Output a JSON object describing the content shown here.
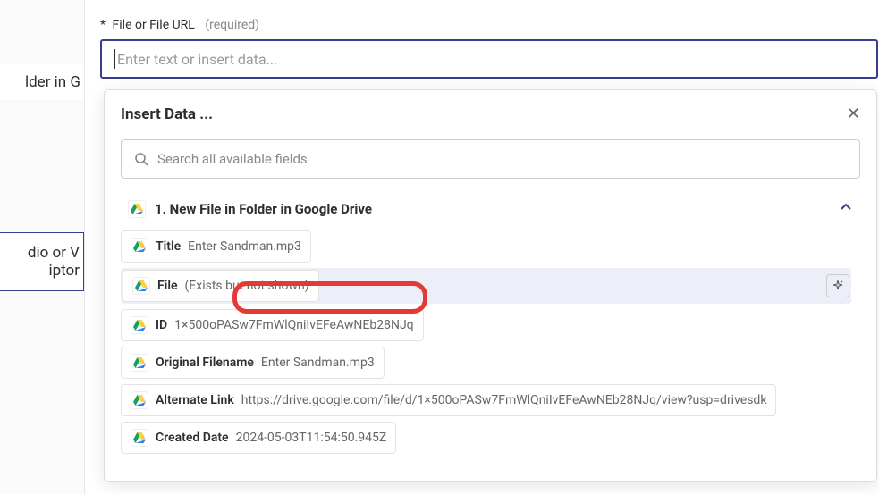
{
  "left": {
    "row1": "lder in G",
    "row2a": "dio or V",
    "row2b": "iptor"
  },
  "field": {
    "star": "*",
    "label": "File or File URL",
    "required": "(required)",
    "placeholder": "Enter text or insert data..."
  },
  "popup": {
    "title": "Insert Data ...",
    "search_placeholder": "Search all available fields",
    "source_title": "1. New File in Folder in Google Drive",
    "fields": [
      {
        "name": "Title",
        "value": "Enter Sandman.mp3"
      },
      {
        "name": "File",
        "value": "(Exists but not shown)"
      },
      {
        "name": "ID",
        "value": "1×500oPASw7FmWlQniIvEFeAwNEb28NJq"
      },
      {
        "name": "Original Filename",
        "value": "Enter Sandman.mp3"
      },
      {
        "name": "Alternate Link",
        "value": "https://drive.google.com/file/d/1×500oPASw7FmWlQniIvEFeAwNEb28NJq/view?usp=drivesdk"
      },
      {
        "name": "Created Date",
        "value": "2024-05-03T11:54:50.945Z"
      }
    ]
  }
}
